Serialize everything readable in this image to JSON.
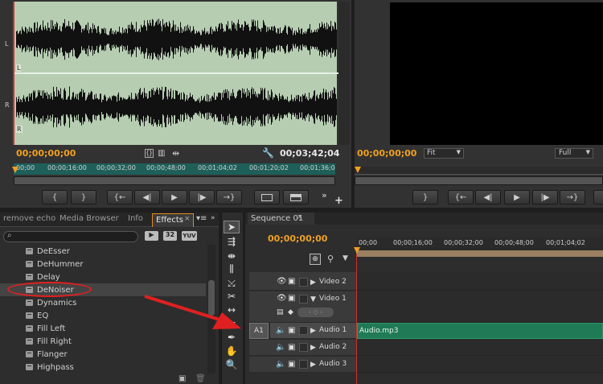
{
  "source_monitor": {
    "channel_left": "L",
    "channel_right": "R",
    "channel_left_marker": "L",
    "channel_right_marker": "R",
    "timecode_current": "00;00;00;00",
    "timecode_duration": "00;03;42;04",
    "ruler_ticks": [
      "00;00",
      "00;00;16;00",
      "00;00;32;00",
      "00;00;48;00",
      "00;01;04;02",
      "00;01;20;02",
      "00;01;36;0"
    ],
    "transport_buttons": [
      "{",
      "}",
      "{←",
      "◀|",
      "▶",
      "|▶",
      "→}",
      "insert",
      "overwrite"
    ]
  },
  "program_monitor": {
    "timecode_current": "00;00;00;00",
    "fit_label": "Fit",
    "quality_label": "Full",
    "transport_buttons": [
      "}",
      "{←",
      "◀|",
      "▶",
      "|▶",
      "→}"
    ]
  },
  "effects_panel": {
    "tabs": [
      "remove echo",
      "Media Browser",
      "Info",
      "Effects"
    ],
    "active_tab": "Effects",
    "filter_icons": [
      "32",
      "YUV"
    ],
    "search_value": "",
    "items": [
      "DeEsser",
      "DeHummer",
      "Delay",
      "DeNoiser",
      "Dynamics",
      "EQ",
      "Fill Left",
      "Fill Right",
      "Flanger",
      "Highpass"
    ],
    "highlighted_item": "DeNoiser"
  },
  "sequence": {
    "tab_label": "Sequence 01",
    "timecode": "00;00;00;00",
    "ruler_ticks": [
      "00;00",
      "00;00;16;00",
      "00;00;32;00",
      "00;00;48;00",
      "00;01;04;02"
    ],
    "tracks": [
      {
        "name": "Video 2",
        "type": "video",
        "collapsed": true
      },
      {
        "name": "Video 1",
        "type": "video",
        "collapsed": false
      },
      {
        "name": "Audio 1",
        "type": "audio",
        "source_patch": "A1",
        "clip": "Audio.mp3"
      },
      {
        "name": "Audio 2",
        "type": "audio"
      },
      {
        "name": "Audio 3",
        "type": "audio"
      }
    ]
  },
  "colors": {
    "timecode_orange": "#f0a020",
    "waveform_bg": "#b6cdb2",
    "clip_green": "#1f7a55",
    "annotation_red": "#e02020",
    "playhead_red": "#d03030"
  }
}
